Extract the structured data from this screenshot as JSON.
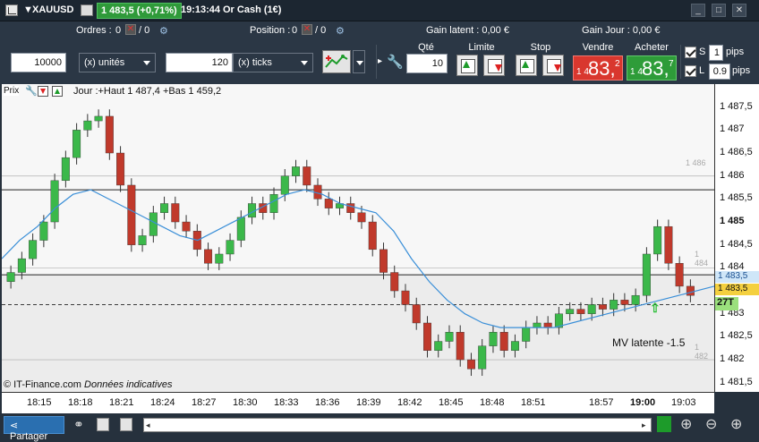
{
  "titlebar": {
    "instrument": "XAUUSD",
    "change": "1 483,5 (+0,71%)",
    "time": "19:13:44",
    "name": "Or Cash (1€)",
    "win_min": "_",
    "win_max": "□",
    "win_close": "✕"
  },
  "infobar": {
    "orders_label": "Ordres :",
    "orders_value": "0",
    "orders_sep": "/ 0",
    "position_label": "Position :",
    "position_value": "0",
    "position_sep": "/ 0",
    "gain_latent": "Gain latent : 0,00 €",
    "gain_jour": "Gain Jour : 0,00 €"
  },
  "orderbar": {
    "quantity_value": "10000",
    "units_label": "(x) unités",
    "ticks_value": "120",
    "ticks_label": "(x) ticks",
    "qte_label": "Qté",
    "qte_value": "10",
    "limite_label": "Limite",
    "stop_label": "Stop",
    "vendre_label": "Vendre",
    "acheter_label": "Acheter",
    "sell_small": "1 4",
    "sell_big": "83,",
    "sell_exp": "2",
    "buy_small": "1 4",
    "buy_big": "83,",
    "buy_exp": "7",
    "s_label": "S",
    "s_value": "1",
    "l_label": "L",
    "l_value": "0.9",
    "pips_label": "pips"
  },
  "chart": {
    "prix_label": "Prix",
    "legend": "Jour :+Haut 1 487,4 +Bas 1 459,2",
    "watermark": "© IT-Finance.com",
    "watermark_italic": "Données indicatives",
    "mv_latente": "MV latente -1.5",
    "badge_27t": "27T",
    "line_label_1486": "1 486",
    "line_label_1484": "1 484",
    "line_label_1482": "1 482",
    "price_tag_blue": "1 483,5",
    "price_tag_yellow": "1 483,5"
  },
  "chart_data": {
    "type": "candlestick",
    "title": "",
    "xlabel": "",
    "ylabel": "",
    "ylim": [
      1481.3,
      1488.0
    ],
    "y_ticks": [
      "1 487,5",
      "1 487",
      "1 486,5",
      "1 486",
      "1 485,5",
      "1 485",
      "1 484,5",
      "1 484",
      "1 483,5",
      "1 483",
      "1 482,5",
      "1 482",
      "1 481,5"
    ],
    "x_ticks": [
      "18:15",
      "18:18",
      "18:21",
      "18:24",
      "18:27",
      "18:30",
      "18:33",
      "18:36",
      "18:39",
      "18:42",
      "18:45",
      "18:48",
      "18:51",
      "18:57",
      "19:00",
      "19:03"
    ],
    "horizontal_lines": [
      1486.0,
      1485.7,
      1484.0,
      1483.85,
      1483.2,
      1482.0
    ],
    "close_series": [
      1483.9,
      1484.2,
      1484.6,
      1485.0,
      1485.9,
      1486.4,
      1487.0,
      1487.2,
      1487.3,
      1486.5,
      1485.8,
      1484.5,
      1484.7,
      1485.2,
      1485.4,
      1485.0,
      1484.8,
      1484.4,
      1484.1,
      1484.3,
      1484.6,
      1485.1,
      1485.4,
      1485.2,
      1485.6,
      1486.0,
      1486.2,
      1485.8,
      1485.5,
      1485.3,
      1485.4,
      1485.2,
      1485.0,
      1484.4,
      1483.9,
      1483.5,
      1483.2,
      1482.8,
      1482.2,
      1482.4,
      1482.6,
      1482.0,
      1481.8,
      1482.3,
      1482.6,
      1482.2,
      1482.4,
      1482.7,
      1482.8,
      1482.7,
      1483.0,
      1483.1,
      1483.0,
      1483.2,
      1483.1,
      1483.3,
      1483.2,
      1483.4,
      1484.3,
      1484.9,
      1484.1,
      1483.6,
      1483.4
    ],
    "ma_series": [
      1484.2,
      1484.6,
      1484.9,
      1485.3,
      1485.6,
      1485.7,
      1485.5,
      1485.3,
      1485.1,
      1484.9,
      1484.7,
      1484.6,
      1484.8,
      1485.0,
      1485.2,
      1485.4,
      1485.6,
      1485.7,
      1485.6,
      1485.4,
      1485.3,
      1485.2,
      1484.8,
      1484.2,
      1483.7,
      1483.3,
      1483.0,
      1482.8,
      1482.7,
      1482.7,
      1482.7,
      1482.7,
      1482.8,
      1482.9,
      1483.0,
      1483.1,
      1483.2,
      1483.3,
      1483.4,
      1483.5,
      1483.6
    ]
  },
  "bottombar": {
    "share_label": "Partager"
  }
}
